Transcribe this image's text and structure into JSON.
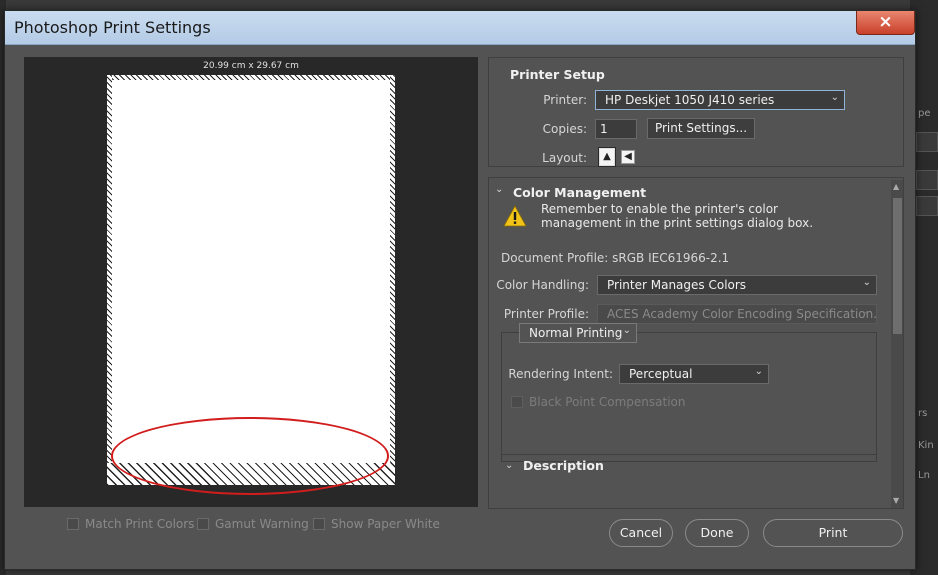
{
  "window": {
    "title": "Photoshop Print Settings",
    "close_icon": "×"
  },
  "preview": {
    "paper_size": "20.99 cm x 29.67 cm",
    "annotation_color": "#d21d1d"
  },
  "preview_options": {
    "match_print_colors": "Match Print Colors",
    "gamut_warning": "Gamut Warning",
    "show_paper_white": "Show Paper White"
  },
  "printer_setup": {
    "section_title": "Printer Setup",
    "printer_label": "Printer:",
    "printer_value": "HP Deskjet 1050 J410 series",
    "copies_label": "Copies:",
    "copies_value": "1",
    "print_settings_button": "Print Settings...",
    "layout_label": "Layout:",
    "layout_options": [
      "portrait-icon",
      "landscape-icon"
    ]
  },
  "color_management": {
    "section_title": "Color Management",
    "warning_line1": "Remember to enable the printer's color",
    "warning_line2": "management in the print settings dialog box.",
    "document_profile": "Document Profile: sRGB IEC61966-2.1",
    "color_handling_label": "Color Handling:",
    "color_handling_value": "Printer Manages Colors",
    "printer_profile_label": "Printer Profile:",
    "printer_profile_value": "ACES Academy Color Encoding Specification...",
    "print_mode_value": "Normal Printing",
    "rendering_intent_label": "Rendering Intent:",
    "rendering_intent_value": "Perceptual",
    "black_point_label": "Black Point Compensation"
  },
  "description": {
    "section_title": "Description"
  },
  "actions": {
    "cancel": "Cancel",
    "done": "Done",
    "print": "Print"
  },
  "background_app": {
    "frag_1": "pe",
    "frag_2": "rs",
    "frag_3": "Kin",
    "frag_4": "Ln"
  }
}
